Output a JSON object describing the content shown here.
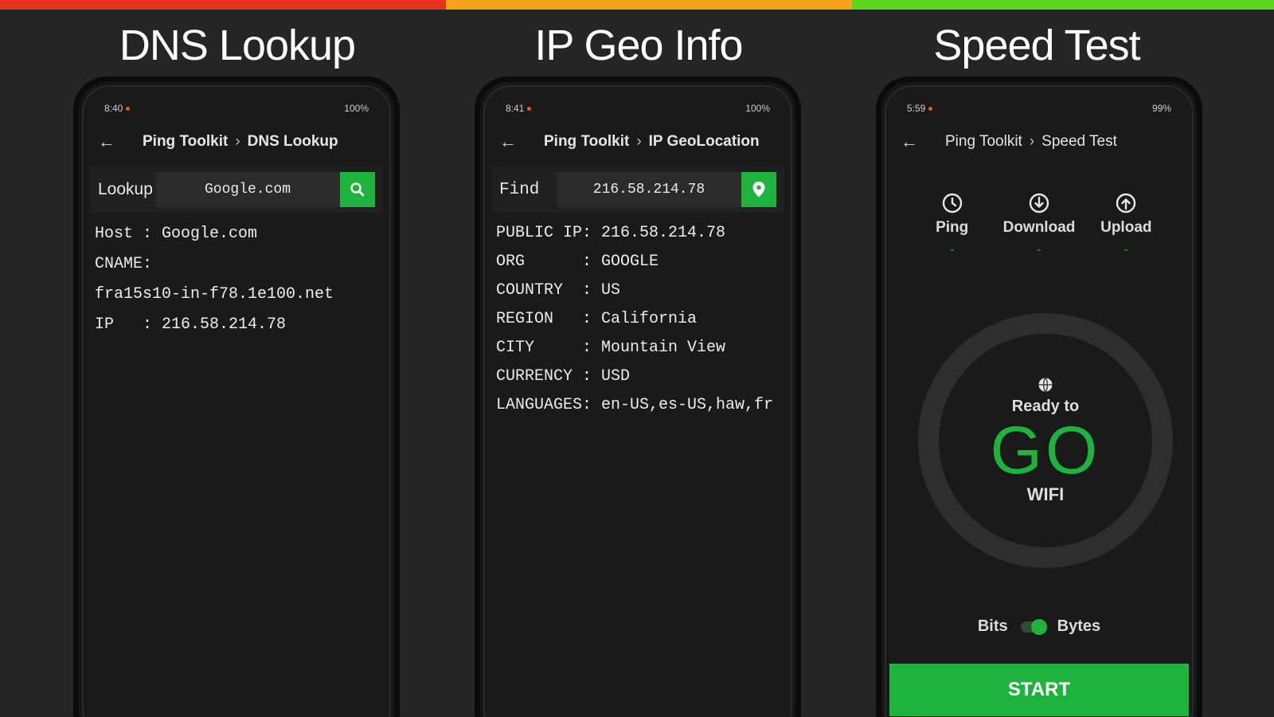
{
  "colors": {
    "accent": "#1eb33c",
    "bar_red": "#e8321c",
    "bar_orange": "#f5a31a",
    "bar_green": "#5bd61e"
  },
  "panels": [
    {
      "title": "DNS Lookup",
      "status_time": "8:40",
      "status_right": "100%",
      "breadcrumb": [
        "Ping Toolkit",
        "DNS Lookup"
      ],
      "search_label": "Lookup",
      "search_value": "Google.com",
      "search_icon": "search-icon",
      "lines": [
        "Host : Google.com",
        "CNAME:",
        "fra15s10-in-f78.1e100.net",
        "IP   : 216.58.214.78"
      ]
    },
    {
      "title": "IP Geo Info",
      "status_time": "8:41",
      "status_right": "100%",
      "breadcrumb": [
        "Ping Toolkit",
        "IP GeoLocation"
      ],
      "search_label": "Find",
      "search_value": "216.58.214.78",
      "search_icon": "location-pin-icon",
      "lines": [
        "PUBLIC IP: 216.58.214.78",
        "ORG      : GOOGLE",
        "COUNTRY  : US",
        "REGION   : California",
        "CITY     : Mountain View",
        "CURRENCY : USD",
        "LANGUAGES: en-US,es-US,haw,fr"
      ]
    },
    {
      "title": "Speed Test",
      "status_time": "5:59",
      "status_right": "99%",
      "breadcrumb": [
        "Ping Toolkit",
        "Speed Test"
      ],
      "metrics": [
        {
          "label": "Ping",
          "value": "-",
          "icon": "clock-icon"
        },
        {
          "label": "Download",
          "value": "-",
          "icon": "download-icon"
        },
        {
          "label": "Upload",
          "value": "-",
          "icon": "upload-icon"
        }
      ],
      "ready_text": "Ready to",
      "go_text": "GO",
      "network": "WIFI",
      "unit_left": "Bits",
      "unit_right": "Bytes",
      "start_label": "START"
    }
  ]
}
